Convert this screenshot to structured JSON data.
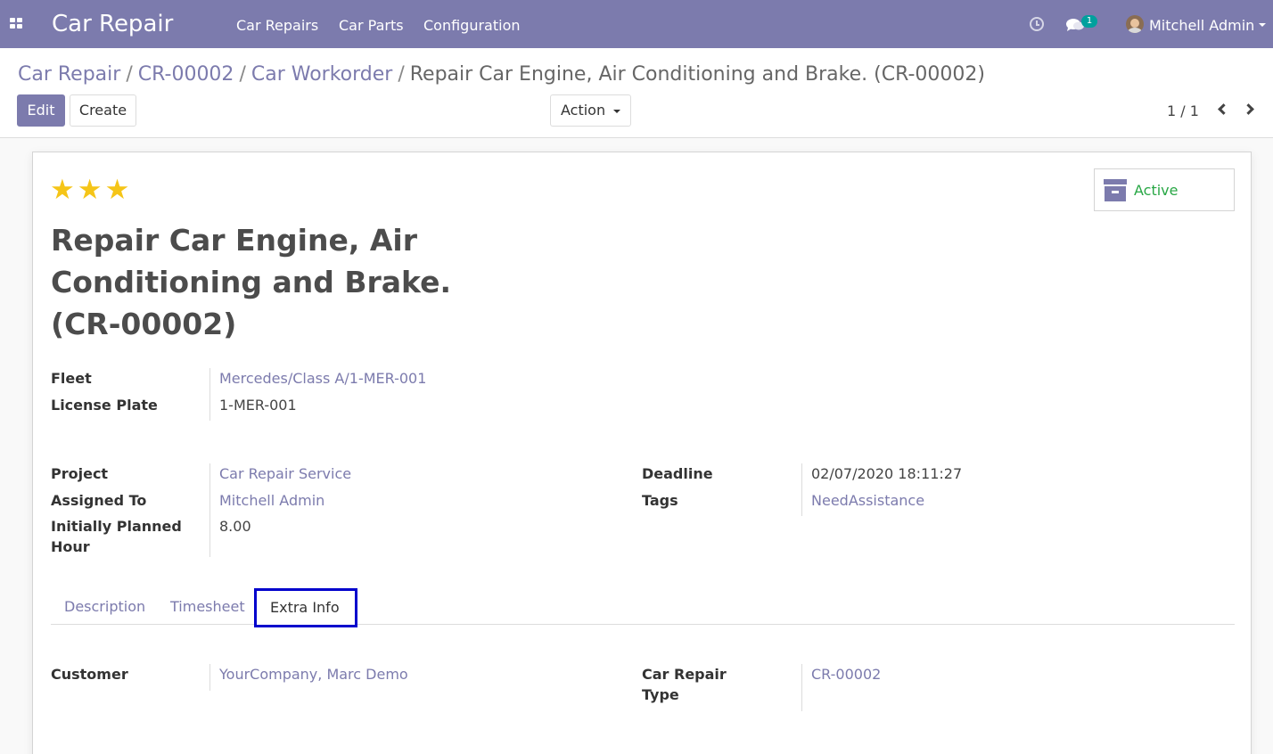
{
  "navbar": {
    "brand": "Car Repair",
    "menu": [
      "Car Repairs",
      "Car Parts",
      "Configuration"
    ],
    "chat_count": "1",
    "user": "Mitchell Admin",
    "bg_color": "#7c7bad"
  },
  "breadcrumb": {
    "items": [
      "Car Repair",
      "CR-00002",
      "Car Workorder"
    ],
    "current": "Repair Car Engine, Air Conditioning and Brake. (CR-00002)"
  },
  "toolbar": {
    "edit_label": "Edit",
    "create_label": "Create",
    "action_label": "Action",
    "pager": "1 / 1"
  },
  "record": {
    "stars": 3,
    "title": "Repair Car Engine, Air Conditioning and Brake. (CR-00002)",
    "status": "Active",
    "fleet_label": "Fleet",
    "fleet": "Mercedes/Class A/1-MER-001",
    "license_plate_label": "License Plate",
    "license_plate": "1-MER-001",
    "project_label": "Project",
    "project": "Car Repair Service",
    "assigned_to_label": "Assigned To",
    "assigned_to": "Mitchell Admin",
    "planned_hours_label": "Initially Planned Hour",
    "planned_hours": "8.00",
    "deadline_label": "Deadline",
    "deadline": "02/07/2020 18:11:27",
    "tags_label": "Tags",
    "tags": "NeedAssistance"
  },
  "tabs": {
    "items": [
      "Description",
      "Timesheet",
      "Extra Info"
    ],
    "active": "Extra Info"
  },
  "extra_info": {
    "customer_label": "Customer",
    "customer": "YourCompany, Marc Demo",
    "car_repair_type_label": "Car Repair Type",
    "car_repair_type": "CR-00002"
  }
}
